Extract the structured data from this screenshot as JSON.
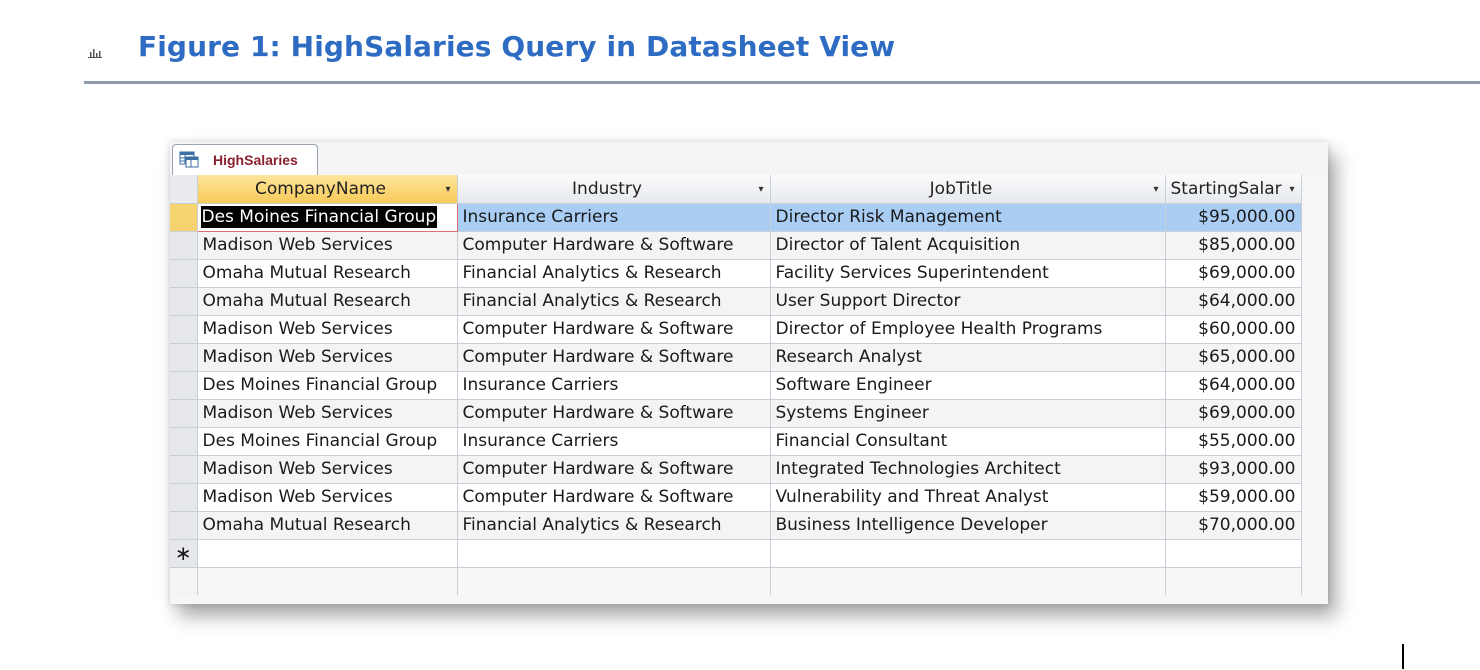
{
  "figure": {
    "title": "Figure 1: HighSalaries Query in Datasheet View",
    "icon": "bar-chart-icon"
  },
  "window": {
    "tab_label": "HighSalaries",
    "tab_icon": "query-icon",
    "new_record_marker": "∗"
  },
  "table": {
    "columns": [
      "CompanyName",
      "Industry",
      "JobTitle",
      "StartingSalar"
    ],
    "rows": [
      [
        "Des Moines Financial Group",
        "Insurance Carriers",
        "Director Risk Management",
        "$95,000.00"
      ],
      [
        "Madison Web Services",
        "Computer Hardware & Software",
        "Director of Talent Acquisition",
        "$85,000.00"
      ],
      [
        "Omaha Mutual Research",
        "Financial Analytics & Research",
        "Facility Services Superintendent",
        "$69,000.00"
      ],
      [
        "Omaha Mutual Research",
        "Financial Analytics & Research",
        "User Support Director",
        "$64,000.00"
      ],
      [
        "Madison Web Services",
        "Computer Hardware & Software",
        "Director of Employee Health Programs",
        "$60,000.00"
      ],
      [
        "Madison Web Services",
        "Computer Hardware & Software",
        "Research Analyst",
        "$65,000.00"
      ],
      [
        "Des Moines Financial Group",
        "Insurance Carriers",
        "Software Engineer",
        "$64,000.00"
      ],
      [
        "Madison Web Services",
        "Computer Hardware & Software",
        "Systems Engineer",
        "$69,000.00"
      ],
      [
        "Des Moines Financial Group",
        "Insurance Carriers",
        "Financial Consultant",
        "$55,000.00"
      ],
      [
        "Madison Web Services",
        "Computer Hardware & Software",
        "Integrated Technologies Architect",
        "$93,000.00"
      ],
      [
        "Madison Web Services",
        "Computer Hardware & Software",
        "Vulnerability and Threat Analyst",
        "$59,000.00"
      ],
      [
        "Omaha Mutual Research",
        "Financial Analytics & Research",
        "Business Intelligence Developer",
        "$70,000.00"
      ]
    ]
  },
  "colors": {
    "heading": "#2e6bc2",
    "rule": "#8c9aa9",
    "selected_header": "#f7ca5a",
    "current_row": "#a9cdf3",
    "tab_label": "#8a2030"
  }
}
